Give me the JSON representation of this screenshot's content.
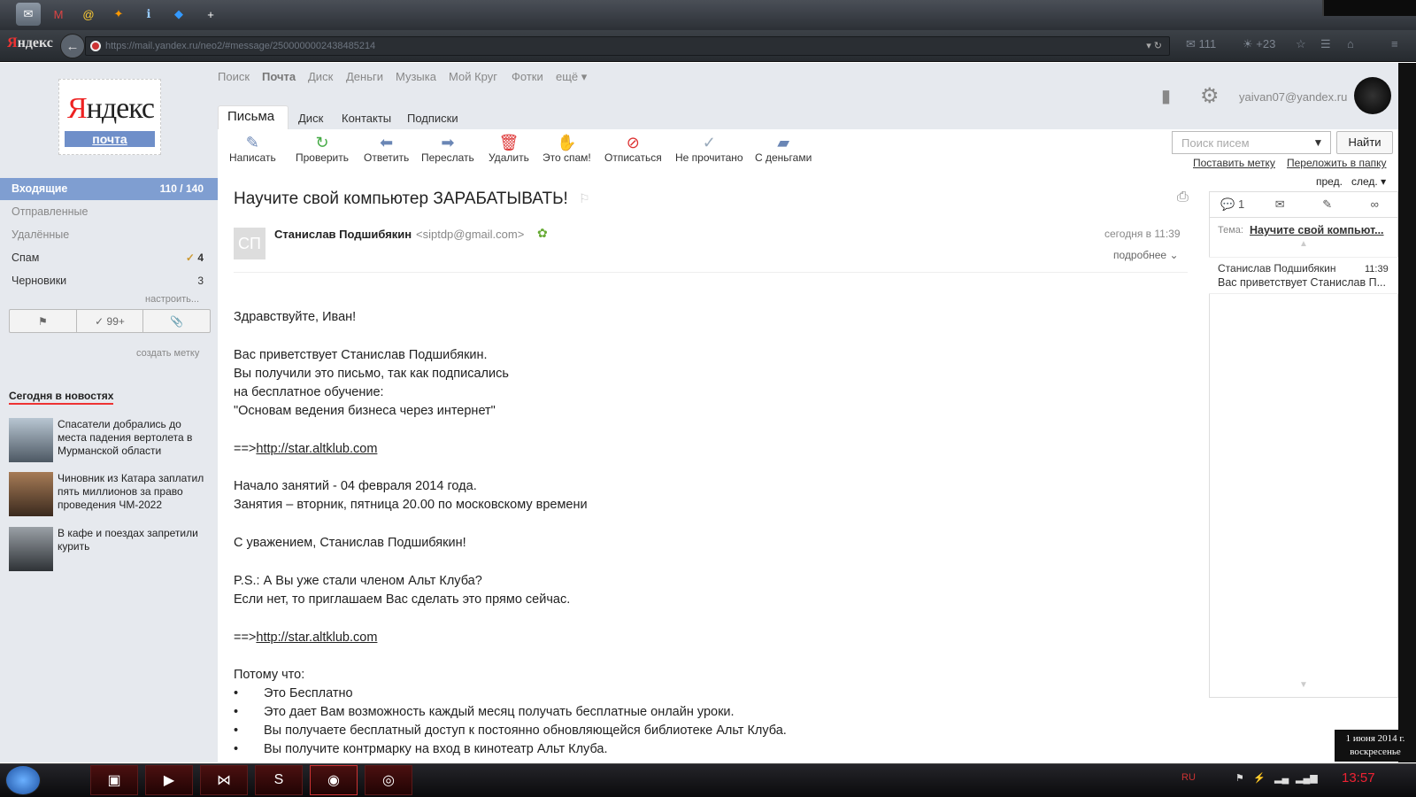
{
  "browser": {
    "brand_first": "Я",
    "brand_rest": "ндекс",
    "url": "https://mail.yandex.ru/neo2/#message/2500000002438485214",
    "mail_count": "111",
    "weather": "+23",
    "new_tab": "+"
  },
  "logo": {
    "name_red": "Я",
    "name_rest": "ндекс",
    "service": "почта"
  },
  "top_nav": [
    "Поиск",
    "Почта",
    "Диск",
    "Деньги",
    "Музыка",
    "Мой Круг",
    "Фотки",
    "ещё ▾"
  ],
  "sub_tabs": {
    "active": "Письма",
    "items": [
      "Диск",
      "Контакты",
      "Подписки"
    ]
  },
  "user": {
    "email": "yaivan07@yandex.ru"
  },
  "toolbar": [
    {
      "label": "Написать",
      "icon": "compose-icon"
    },
    {
      "label": "Проверить",
      "icon": "refresh-icon"
    },
    {
      "label": "Ответить",
      "icon": "reply-icon"
    },
    {
      "label": "Переслать",
      "icon": "forward-icon"
    },
    {
      "label": "Удалить",
      "icon": "trash-icon"
    },
    {
      "label": "Это спам!",
      "icon": "spam-icon"
    },
    {
      "label": "Отписаться",
      "icon": "unsubscribe-icon"
    },
    {
      "label": "Не прочитано",
      "icon": "unread-icon"
    },
    {
      "label": "С деньгами",
      "icon": "money-icon"
    }
  ],
  "search": {
    "placeholder": "Поиск писем",
    "button": "Найти",
    "dropdown": "▼"
  },
  "actions": {
    "set_label": "Поставить метку",
    "move_folder": "Переложить в папку",
    "prev": "пред.",
    "next": "след. ▾"
  },
  "folders": [
    {
      "name": "Входящие",
      "count": "110 / 140",
      "selected": true
    },
    {
      "name": "Отправленные",
      "count": ""
    },
    {
      "name": "Удалённые",
      "count": ""
    },
    {
      "name": "Спам",
      "count": "4"
    },
    {
      "name": "Черновики",
      "count": "3"
    }
  ],
  "folders_configure": "настроить...",
  "filter_buttons": {
    "flag": "⚑",
    "checked": "✓ 99+",
    "attach": "📎"
  },
  "create_label": "создать метку",
  "news": {
    "title": "Сегодня в новостях",
    "items": [
      "Спасатели добрались до места падения вертолета в Мурманской области",
      "Чиновник из Катара заплатил пять миллионов за право проведения ЧМ-2022",
      "В кафе и поездах запретили курить"
    ]
  },
  "message": {
    "subject": "Научите свой компьютер ЗАРАБАТЫВАТЬ!",
    "avatar_initials": "СП",
    "sender_name": "Станислав Подшибякин",
    "sender_email": "<siptdp@gmail.com>",
    "time": "сегодня в 11:39",
    "more": "подробнее ⌄",
    "body": {
      "greeting": "Здравствуйте, Иван!",
      "p1": "Вас приветствует Станислав Подшибякин.",
      "p2": "Вы получили это письмо, так как подписались",
      "p3": "на бесплатное обучение:",
      "p4": "\"Основам ведения бизнеса через интернет\"",
      "arrow": "==>",
      "link": "http://star.altklub.com",
      "start": "Начало занятий - 04 февраля 2014 года.",
      "schedule": "Занятия – вторник, пятница 20.00 по московскому времени",
      "regards": "С уважением, Станислав Подшибякин!",
      "ps1": "P.S.: А Вы уже стали членом Альт Клуба?",
      "ps2": "Если нет, то приглашаем Вас сделать это прямо сейчас.",
      "because": "Потому что:",
      "bullets": [
        "Это Бесплатно",
        "Это дает Вам возможность каждый месяц получать бесплатные онлайн уроки.",
        "Вы получаете бесплатный доступ к постоянно обновляющейся библиотеке Альт Клуба.",
        "Вы получите контрмарку на вход в кинотеатр Альт Клуба."
      ]
    }
  },
  "thread": {
    "tab_count": "1",
    "theme_label": "Тема:",
    "theme": "Научите свой компьют...",
    "item_from": "Станислав Подшибякин",
    "item_time": "11:39",
    "item_snippet": "Вас приветствует Станислав П..."
  },
  "taskbar": {
    "lang": "RU",
    "time": "13:57",
    "date": "1 июня 2014 г.",
    "weekday": "воскресенье"
  }
}
